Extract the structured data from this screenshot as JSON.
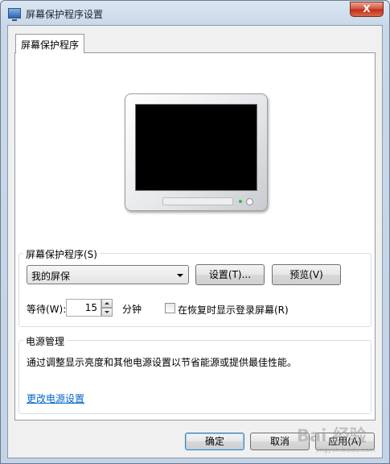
{
  "window": {
    "title": "屏幕保护程序设置",
    "close_label": "X"
  },
  "tabs": [
    {
      "label": "屏幕保护程序"
    }
  ],
  "screensaver_group": {
    "label": "屏幕保护程序(S)",
    "selected": "我的屏保",
    "settings_button": "设置(T)...",
    "preview_button": "预览(V)",
    "wait_label": "等待(W):",
    "wait_value": "15",
    "wait_unit": "分钟",
    "resume_checkbox_label": "在恢复时显示登录屏幕(R)",
    "resume_checked": false
  },
  "power_group": {
    "label": "电源管理",
    "description": "通过调整显示亮度和其他电源设置以节省能源或提供最佳性能。",
    "link": "更改电源设置"
  },
  "footer": {
    "ok_button": "确定",
    "cancel_button": "取消",
    "apply_button": "应用(A)"
  },
  "watermark": {
    "text": "Bai 经验",
    "sub": "jingyan.baidu.com"
  },
  "colors": {
    "link": "#0066cc",
    "close_button": "#c22b14",
    "screen": "#000000"
  }
}
